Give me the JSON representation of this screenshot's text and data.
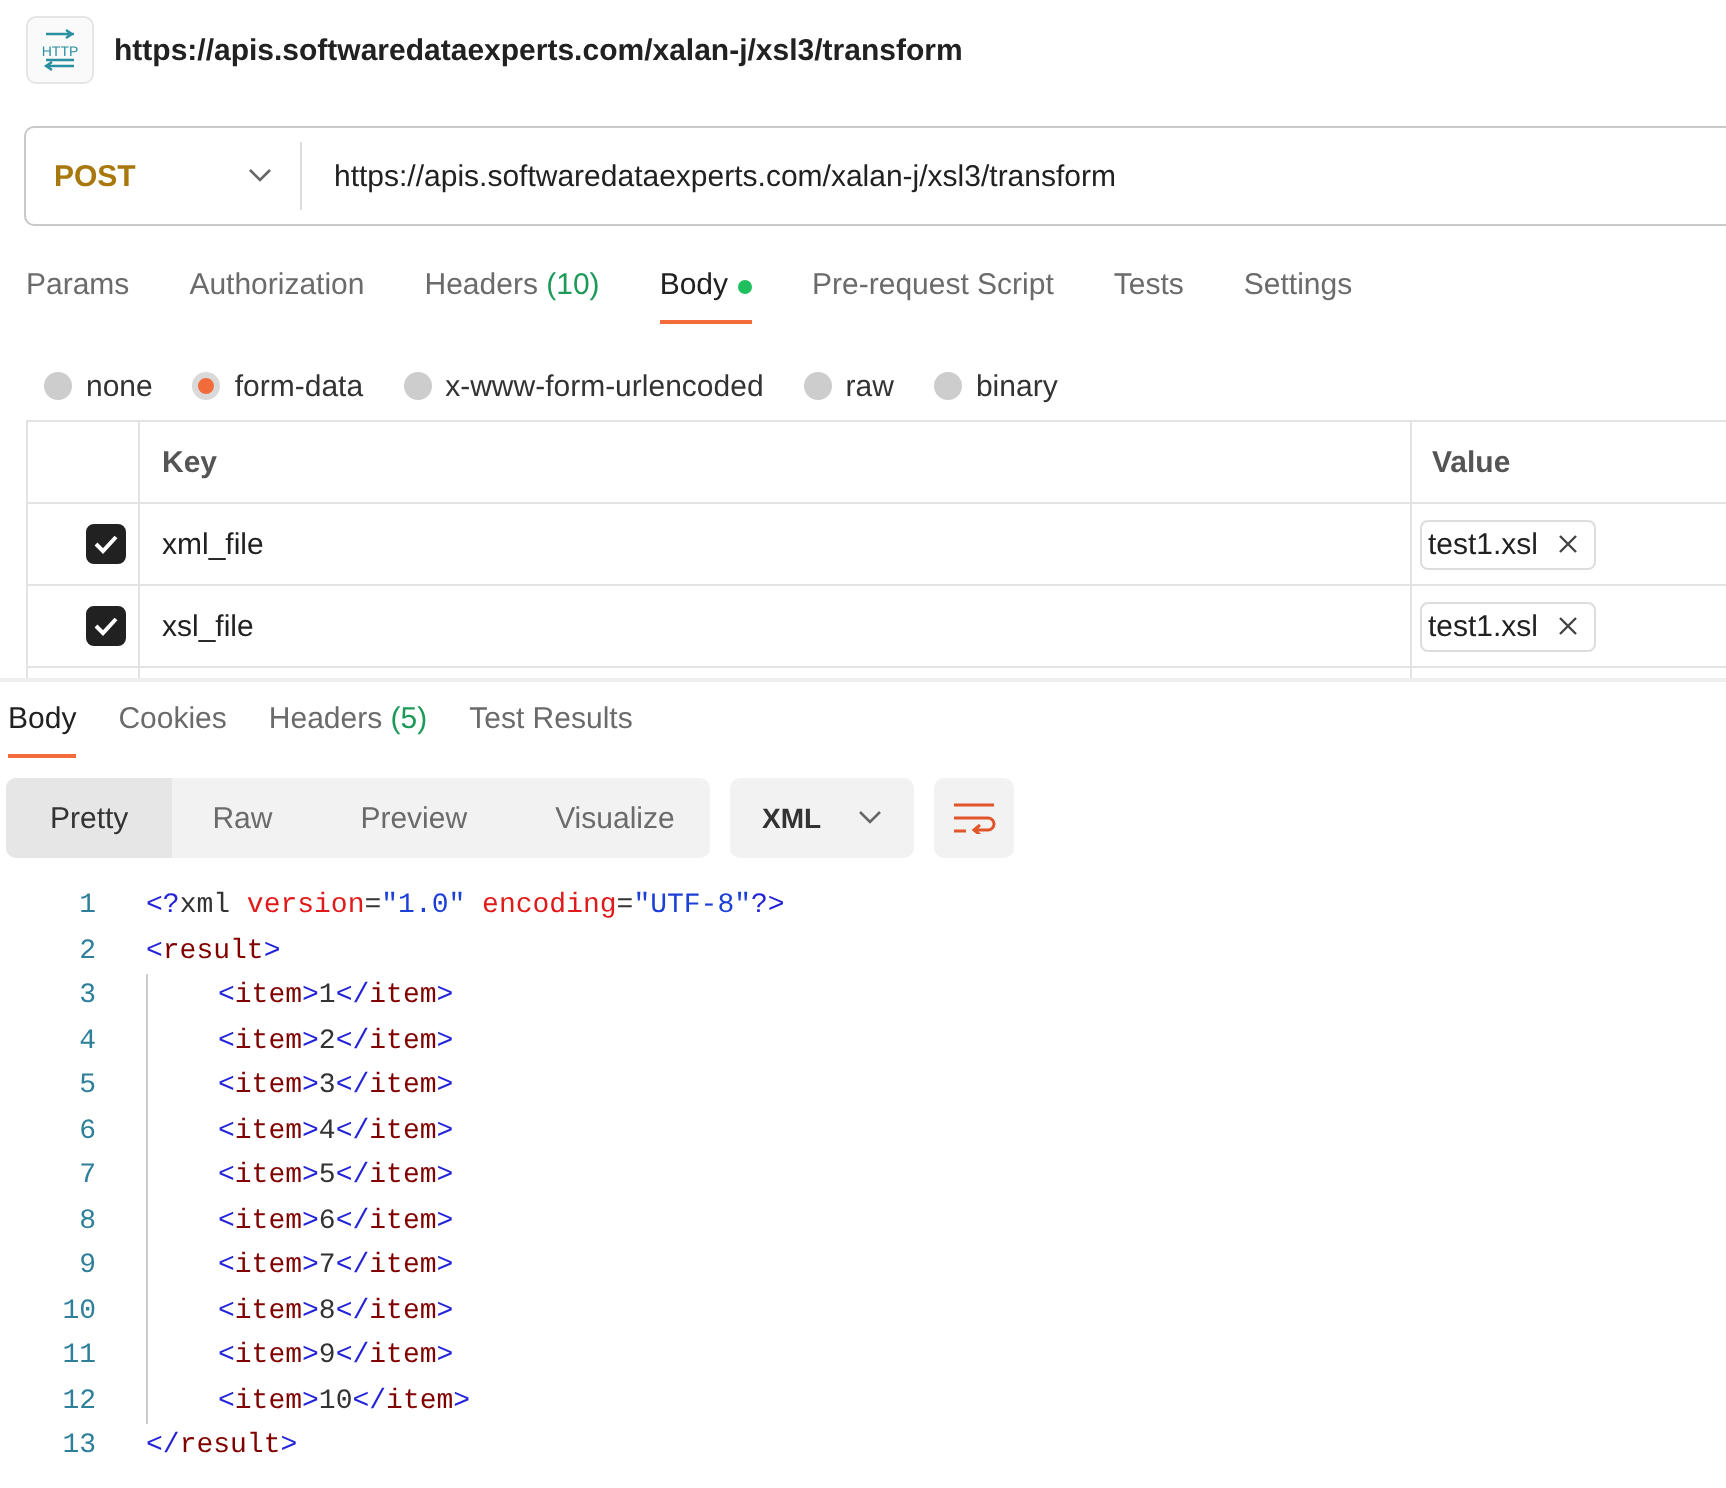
{
  "header": {
    "icon_label": "HTTP",
    "title": "https://apis.softwaredataexperts.com/xalan-j/xsl3/transform"
  },
  "request": {
    "method": "POST",
    "url": "https://apis.softwaredataexperts.com/xalan-j/xsl3/transform"
  },
  "request_tabs": [
    {
      "label": "Params",
      "dot": false,
      "selected": false
    },
    {
      "label": "Authorization",
      "dot": false,
      "selected": false
    },
    {
      "label": "Headers",
      "count": "(10)",
      "dot": false,
      "selected": false
    },
    {
      "label": "Body",
      "dot": true,
      "selected": true
    },
    {
      "label": "Pre-request Script",
      "dot": false,
      "selected": false
    },
    {
      "label": "Tests",
      "dot": false,
      "selected": false
    },
    {
      "label": "Settings",
      "dot": false,
      "selected": false
    }
  ],
  "body_types": [
    {
      "label": "none",
      "selected": false
    },
    {
      "label": "form-data",
      "selected": true
    },
    {
      "label": "x-www-form-urlencoded",
      "selected": false
    },
    {
      "label": "raw",
      "selected": false
    },
    {
      "label": "binary",
      "selected": false
    }
  ],
  "form_table": {
    "columns": [
      "Key",
      "Value"
    ],
    "rows": [
      {
        "checked": true,
        "key": "xml_file",
        "file": "test1.xsl"
      },
      {
        "checked": true,
        "key": "xsl_file",
        "file": "test1.xsl"
      }
    ]
  },
  "response_tabs": [
    {
      "label": "Body",
      "selected": true
    },
    {
      "label": "Cookies",
      "selected": false
    },
    {
      "label": "Headers",
      "count": "(5)",
      "selected": false
    },
    {
      "label": "Test Results",
      "selected": false
    }
  ],
  "view_modes": [
    {
      "label": "Pretty",
      "selected": true
    },
    {
      "label": "Raw",
      "selected": false
    },
    {
      "label": "Preview",
      "selected": false
    },
    {
      "label": "Visualize",
      "selected": false
    }
  ],
  "format": "XML",
  "code": [
    {
      "number": "1",
      "tokens": [
        {
          "kind": "punct",
          "text": "<?"
        },
        {
          "kind": "plain",
          "text": "xml "
        },
        {
          "kind": "attr",
          "text": "version"
        },
        {
          "kind": "plain",
          "text": "="
        },
        {
          "kind": "value",
          "text": "\"1.0\""
        },
        {
          "kind": "attr",
          "text": " encoding"
        },
        {
          "kind": "plain",
          "text": "="
        },
        {
          "kind": "value",
          "text": "\"UTF-8\""
        },
        {
          "kind": "punct",
          "text": "?>"
        }
      ]
    },
    {
      "number": "2",
      "tokens": [
        {
          "kind": "punct",
          "text": "<"
        },
        {
          "kind": "tag",
          "text": "result"
        },
        {
          "kind": "punct",
          "text": ">"
        }
      ],
      "children": [
        {
          "number": "3",
          "tokens": [
            {
              "kind": "punct",
              "text": "<"
            },
            {
              "kind": "tag",
              "text": "item"
            },
            {
              "kind": "punct",
              "text": ">"
            },
            {
              "kind": "plain",
              "text": "1"
            },
            {
              "kind": "punct",
              "text": "</"
            },
            {
              "kind": "tag",
              "text": "item"
            },
            {
              "kind": "punct",
              "text": ">"
            }
          ]
        },
        {
          "number": "4",
          "tokens": [
            {
              "kind": "punct",
              "text": "<"
            },
            {
              "kind": "tag",
              "text": "item"
            },
            {
              "kind": "punct",
              "text": ">"
            },
            {
              "kind": "plain",
              "text": "2"
            },
            {
              "kind": "punct",
              "text": "</"
            },
            {
              "kind": "tag",
              "text": "item"
            },
            {
              "kind": "punct",
              "text": ">"
            }
          ]
        },
        {
          "number": "5",
          "tokens": [
            {
              "kind": "punct",
              "text": "<"
            },
            {
              "kind": "tag",
              "text": "item"
            },
            {
              "kind": "punct",
              "text": ">"
            },
            {
              "kind": "plain",
              "text": "3"
            },
            {
              "kind": "punct",
              "text": "</"
            },
            {
              "kind": "tag",
              "text": "item"
            },
            {
              "kind": "punct",
              "text": ">"
            }
          ]
        },
        {
          "number": "6",
          "tokens": [
            {
              "kind": "punct",
              "text": "<"
            },
            {
              "kind": "tag",
              "text": "item"
            },
            {
              "kind": "punct",
              "text": ">"
            },
            {
              "kind": "plain",
              "text": "4"
            },
            {
              "kind": "punct",
              "text": "</"
            },
            {
              "kind": "tag",
              "text": "item"
            },
            {
              "kind": "punct",
              "text": ">"
            }
          ]
        },
        {
          "number": "7",
          "tokens": [
            {
              "kind": "punct",
              "text": "<"
            },
            {
              "kind": "tag",
              "text": "item"
            },
            {
              "kind": "punct",
              "text": ">"
            },
            {
              "kind": "plain",
              "text": "5"
            },
            {
              "kind": "punct",
              "text": "</"
            },
            {
              "kind": "tag",
              "text": "item"
            },
            {
              "kind": "punct",
              "text": ">"
            }
          ]
        },
        {
          "number": "8",
          "tokens": [
            {
              "kind": "punct",
              "text": "<"
            },
            {
              "kind": "tag",
              "text": "item"
            },
            {
              "kind": "punct",
              "text": ">"
            },
            {
              "kind": "plain",
              "text": "6"
            },
            {
              "kind": "punct",
              "text": "</"
            },
            {
              "kind": "tag",
              "text": "item"
            },
            {
              "kind": "punct",
              "text": ">"
            }
          ]
        },
        {
          "number": "9",
          "tokens": [
            {
              "kind": "punct",
              "text": "<"
            },
            {
              "kind": "tag",
              "text": "item"
            },
            {
              "kind": "punct",
              "text": ">"
            },
            {
              "kind": "plain",
              "text": "7"
            },
            {
              "kind": "punct",
              "text": "</"
            },
            {
              "kind": "tag",
              "text": "item"
            },
            {
              "kind": "punct",
              "text": ">"
            }
          ]
        },
        {
          "number": "10",
          "tokens": [
            {
              "kind": "punct",
              "text": "<"
            },
            {
              "kind": "tag",
              "text": "item"
            },
            {
              "kind": "punct",
              "text": ">"
            },
            {
              "kind": "plain",
              "text": "8"
            },
            {
              "kind": "punct",
              "text": "</"
            },
            {
              "kind": "tag",
              "text": "item"
            },
            {
              "kind": "punct",
              "text": ">"
            }
          ]
        },
        {
          "number": "11",
          "tokens": [
            {
              "kind": "punct",
              "text": "<"
            },
            {
              "kind": "tag",
              "text": "item"
            },
            {
              "kind": "punct",
              "text": ">"
            },
            {
              "kind": "plain",
              "text": "9"
            },
            {
              "kind": "punct",
              "text": "</"
            },
            {
              "kind": "tag",
              "text": "item"
            },
            {
              "kind": "punct",
              "text": ">"
            }
          ]
        },
        {
          "number": "12",
          "tokens": [
            {
              "kind": "punct",
              "text": "<"
            },
            {
              "kind": "tag",
              "text": "item"
            },
            {
              "kind": "punct",
              "text": ">"
            },
            {
              "kind": "plain",
              "text": "10"
            },
            {
              "kind": "punct",
              "text": "</"
            },
            {
              "kind": "tag",
              "text": "item"
            },
            {
              "kind": "punct",
              "text": ">"
            }
          ]
        }
      ]
    },
    {
      "number": "13",
      "tokens": [
        {
          "kind": "punct",
          "text": "</"
        },
        {
          "kind": "tag",
          "text": "result"
        },
        {
          "kind": "punct",
          "text": ">"
        }
      ]
    }
  ]
}
